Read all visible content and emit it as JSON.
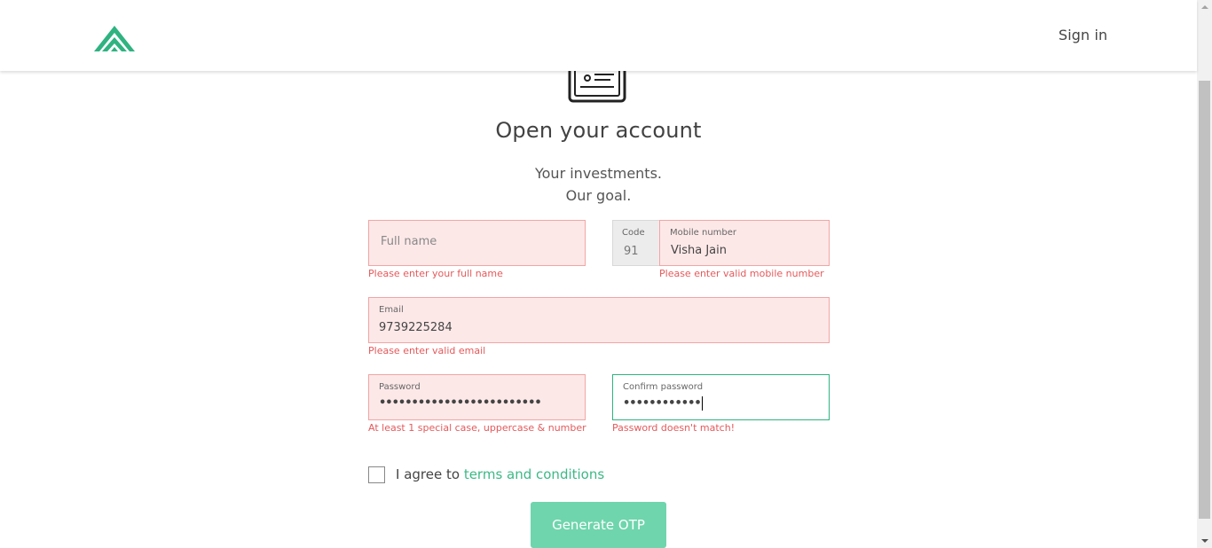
{
  "header": {
    "logo_icon": "chevron-up-logo",
    "signin_label": "Sign in"
  },
  "hero": {
    "icon": "form-document-icon",
    "title": "Open your account",
    "subtitle_line1": "Your investments.",
    "subtitle_line2": "Our goal."
  },
  "form": {
    "full_name": {
      "placeholder": "Full name",
      "value": "",
      "error": "Please enter your full name"
    },
    "code": {
      "label": "Code",
      "value": "91"
    },
    "mobile": {
      "label": "Mobile number",
      "value": "Visha Jain",
      "error": "Please enter valid mobile number"
    },
    "email": {
      "label": "Email",
      "value": "9739225284",
      "error": "Please enter valid email"
    },
    "password": {
      "label": "Password",
      "masked_value": "•••••••••••••••••••••••••",
      "error": "At least 1 special case, uppercase & number"
    },
    "confirm_password": {
      "label": "Confirm password",
      "masked_value": "••••••••••••",
      "error": "Password doesn't match!"
    },
    "agree_text": "I agree to",
    "terms_link": "terms and conditions",
    "submit_label": "Generate OTP"
  },
  "colors": {
    "accent": "#3cb986",
    "button": "#6fd5ac",
    "error": "#e5595b",
    "field_error_bg": "#fde8e8",
    "field_error_border": "#f2a5a5"
  }
}
